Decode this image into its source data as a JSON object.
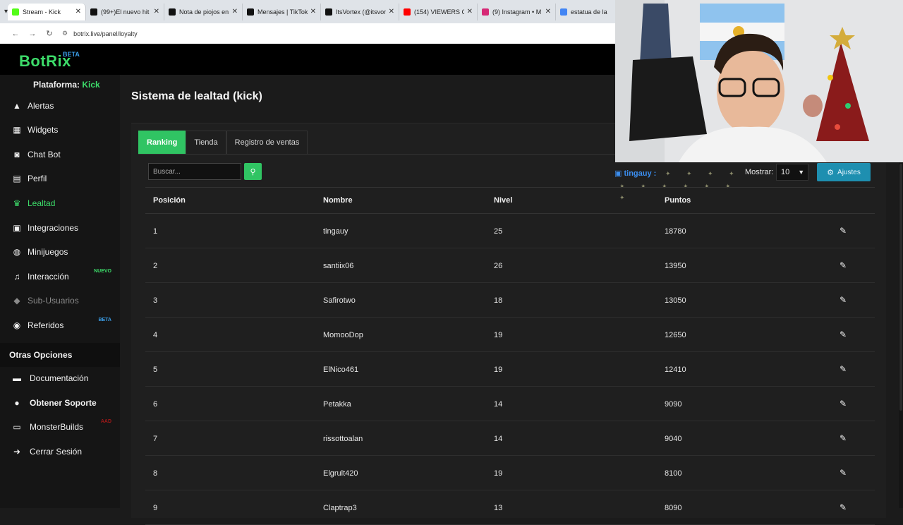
{
  "browser": {
    "tabs": [
      {
        "title": "Stream - Kick",
        "color": "#53fc18",
        "active": true
      },
      {
        "title": "(99+)El nuevo hit",
        "color": "#111111",
        "active": false
      },
      {
        "title": "Nota de piojos en",
        "color": "#111111",
        "active": false
      },
      {
        "title": "Mensajes | TikTok",
        "color": "#111111",
        "active": false
      },
      {
        "title": "ItsVortex (@itsvor",
        "color": "#111111",
        "active": false
      },
      {
        "title": "(154) VIEWERS Cr",
        "color": "#ff0000",
        "active": false
      },
      {
        "title": "(9) Instagram • M",
        "color": "#d62976",
        "active": false
      },
      {
        "title": "estatua de la",
        "color": "#4285f4",
        "active": false
      }
    ],
    "url": "botrix.live/panel/loyalty"
  },
  "app": {
    "logo": "BotRix",
    "logo_badge": "BETA",
    "accent": "#3ddc6a"
  },
  "sidebar": {
    "platform_label": "Plataforma:",
    "platform_value": "Kick",
    "items": [
      {
        "label": "Alertas",
        "icon": "warning-icon",
        "glyph": "▲"
      },
      {
        "label": "Widgets",
        "icon": "grid-icon",
        "glyph": "▦"
      },
      {
        "label": "Chat Bot",
        "icon": "robot-icon",
        "glyph": "◙"
      },
      {
        "label": "Perfil",
        "icon": "id-card-icon",
        "glyph": "▤"
      },
      {
        "label": "Lealtad",
        "icon": "trophy-icon",
        "glyph": "♛"
      },
      {
        "label": "Integraciones",
        "icon": "integration-icon",
        "glyph": "▣"
      },
      {
        "label": "Minijuegos",
        "icon": "gamepad-icon",
        "glyph": "◍"
      },
      {
        "label": "Interacción",
        "icon": "music-icon",
        "glyph": "♫",
        "badge": "NUEVO"
      },
      {
        "label": "Sub-Usuarios",
        "icon": "users-cog-icon",
        "glyph": "◆"
      },
      {
        "label": "Referidos",
        "icon": "users-icon",
        "glyph": "◉",
        "badge": "BETA"
      }
    ],
    "section_title": "Otras Opciones",
    "options": [
      {
        "label": "Documentación",
        "icon": "book-icon",
        "glyph": "▬"
      },
      {
        "label": "Obtener Soporte",
        "icon": "support-icon",
        "glyph": "●"
      },
      {
        "label": "MonsterBuilds",
        "icon": "laptop-icon",
        "glyph": "▭",
        "badge": "AAD"
      },
      {
        "label": "Cerrar Sesión",
        "icon": "logout-icon",
        "glyph": "➜"
      }
    ]
  },
  "main": {
    "title": "Sistema de lealtad (kick)",
    "tabs": [
      "Ranking",
      "Tienda",
      "Registro de ventas"
    ],
    "search_placeholder": "Buscar...",
    "show_label": "Mostrar:",
    "show_value": "10",
    "settings_label": "Ajustes",
    "chat_user": "tingauy",
    "columns": [
      "Posición",
      "Nombre",
      "Nivel",
      "Puntos"
    ],
    "rows": [
      {
        "pos": "1",
        "name": "tingauy",
        "level": "25",
        "points": "18780"
      },
      {
        "pos": "2",
        "name": "santiix06",
        "level": "26",
        "points": "13950"
      },
      {
        "pos": "3",
        "name": "Safirotwo",
        "level": "18",
        "points": "13050"
      },
      {
        "pos": "4",
        "name": "MomooDop",
        "level": "19",
        "points": "12650"
      },
      {
        "pos": "5",
        "name": "ElNico461",
        "level": "19",
        "points": "12410"
      },
      {
        "pos": "6",
        "name": "Petakka",
        "level": "14",
        "points": "9090"
      },
      {
        "pos": "7",
        "name": "rissottoalan",
        "level": "14",
        "points": "9040"
      },
      {
        "pos": "8",
        "name": "Elgrult420",
        "level": "19",
        "points": "8100"
      },
      {
        "pos": "9",
        "name": "Claptrap3",
        "level": "13",
        "points": "8090"
      }
    ]
  }
}
